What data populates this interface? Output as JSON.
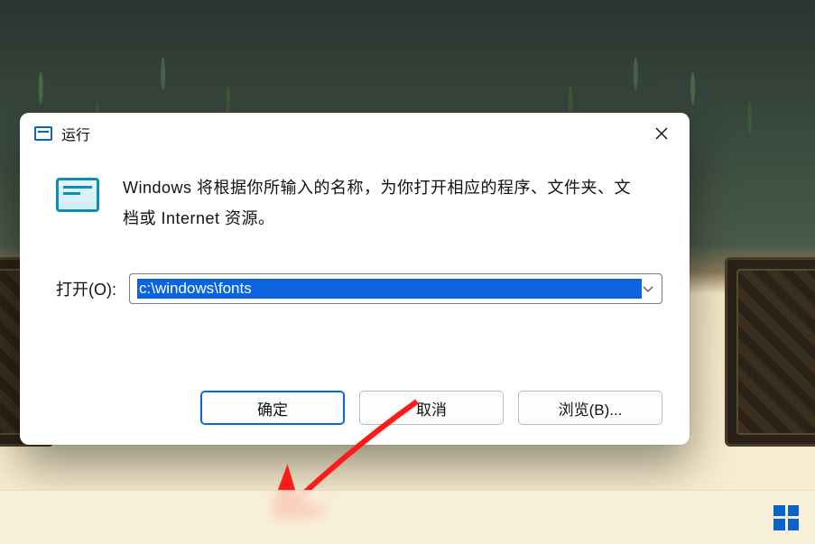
{
  "dialog": {
    "title": "运行",
    "description": "Windows 将根据你所输入的名称，为你打开相应的程序、文件夹、文档或 Internet 资源。",
    "open_label": "打开(O):",
    "input_value": "c:\\windows\\fonts",
    "buttons": {
      "ok": "确定",
      "cancel": "取消",
      "browse": "浏览(B)..."
    }
  }
}
